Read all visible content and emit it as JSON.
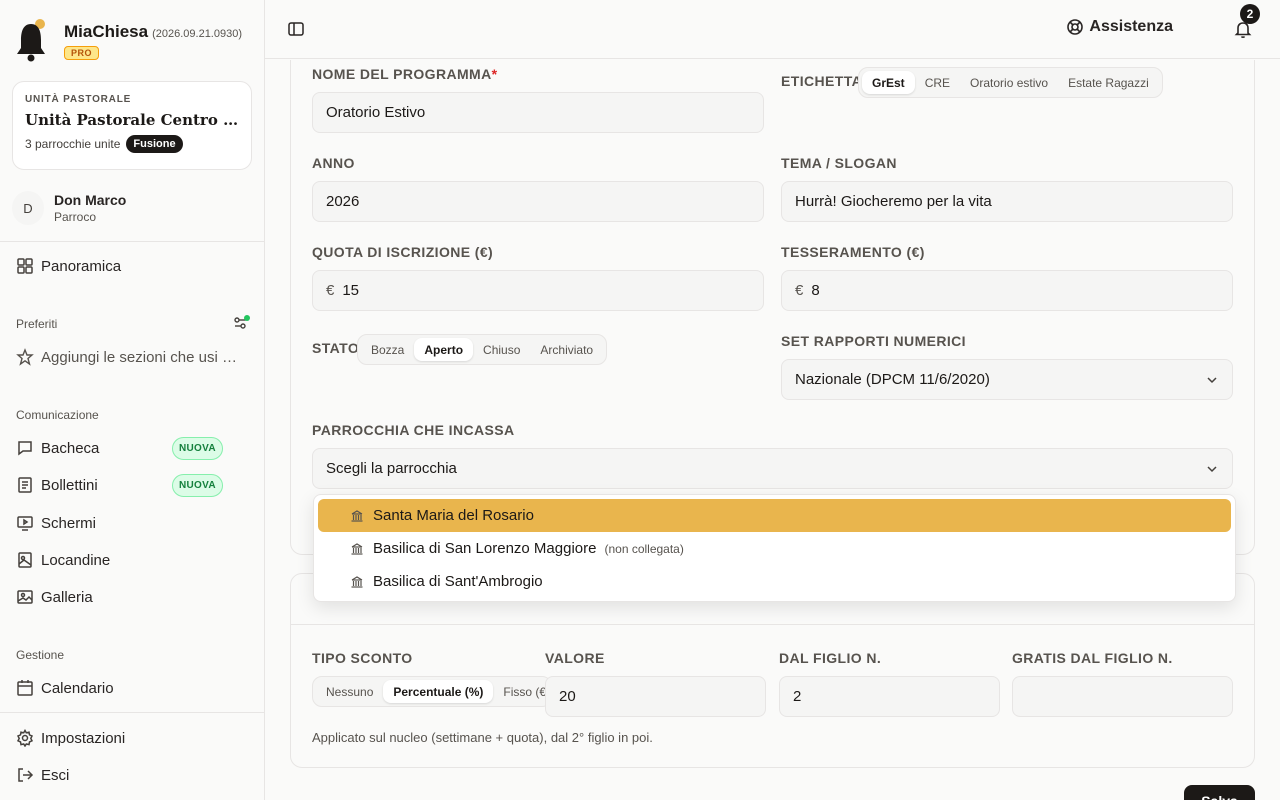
{
  "brand": {
    "name": "MiaChiesa",
    "version": "(2026.09.21.0930)",
    "badge": "PRO"
  },
  "pastoral_unit": {
    "kicker": "UNITÀ PASTORALE",
    "title": "Unità Pastorale Centro Storico",
    "parishes": "3 parrocchie unite",
    "badge": "Fusione"
  },
  "user": {
    "initial": "D",
    "name": "Don Marco",
    "role": "Parroco"
  },
  "sidebar": {
    "overview": "Panoramica",
    "favorites_label": "Preferiti",
    "favorites_hint": "Aggiungi le sezioni che usi di più",
    "communication_label": "Comunicazione",
    "communication": [
      {
        "label": "Bacheca",
        "badge": "NUOVA",
        "icon": "message-icon"
      },
      {
        "label": "Bollettini",
        "badge": "NUOVA",
        "icon": "newspaper-icon"
      },
      {
        "label": "Schermi",
        "badge": "",
        "icon": "screen-icon"
      },
      {
        "label": "Locandine",
        "badge": "",
        "icon": "poster-icon"
      },
      {
        "label": "Galleria",
        "badge": "",
        "icon": "gallery-icon"
      }
    ],
    "management_label": "Gestione",
    "calendar": "Calendario",
    "settings": "Impostazioni",
    "logout": "Esci"
  },
  "topbar": {
    "help": "Assistenza",
    "notifications": "2"
  },
  "form": {
    "program_name_label": "NOME DEL PROGRAMMA",
    "program_name": "Oratorio Estivo",
    "tag_label": "ETICHETTA",
    "tags": [
      "GrEst",
      "CRE",
      "Oratorio estivo",
      "Estate Ragazzi"
    ],
    "tag_selected": "GrEst",
    "year_label": "ANNO",
    "year": "2026",
    "theme_label": "TEMA / SLOGAN",
    "theme": "Hurrà! Giocheremo per la vita",
    "fee_label": "QUOTA DI ISCRIZIONE (€)",
    "fee": "15",
    "membership_label": "TESSERAMENTO (€)",
    "membership": "8",
    "currency": "€",
    "status_label": "STATO",
    "statuses": [
      "Bozza",
      "Aperto",
      "Chiuso",
      "Archiviato"
    ],
    "status_selected": "Aperto",
    "ratios_label": "SET RAPPORTI NUMERICI",
    "ratios": "Nazionale (DPCM 11/6/2020)",
    "parish_label": "PARROCCHIA CHE INCASSA",
    "parish_placeholder": "Scegli la parrocchia",
    "parish_options": [
      {
        "name": "Santa Maria del Rosario",
        "note": ""
      },
      {
        "name": "Basilica di San Lorenzo Maggiore",
        "note": "(non collegata)"
      },
      {
        "name": "Basilica di Sant'Ambrogio",
        "note": ""
      }
    ]
  },
  "discount": {
    "type_label": "TIPO SCONTO",
    "types": [
      "Nessuno",
      "Percentuale (%)",
      "Fisso (€)"
    ],
    "type_selected": "Percentuale (%)",
    "value_label": "VALORE",
    "value": "20",
    "from_child_label": "DAL FIGLIO N.",
    "from_child": "2",
    "free_from_label": "GRATIS DAL FIGLIO N.",
    "free_from": "",
    "hint": "Applicato sul nucleo (settimane + quota), dal 2° figlio in poi."
  },
  "actions": {
    "save": "Salva"
  },
  "colors": {
    "accent": "#e9b54d",
    "dark": "#1c1917",
    "success": "#22c55e"
  }
}
